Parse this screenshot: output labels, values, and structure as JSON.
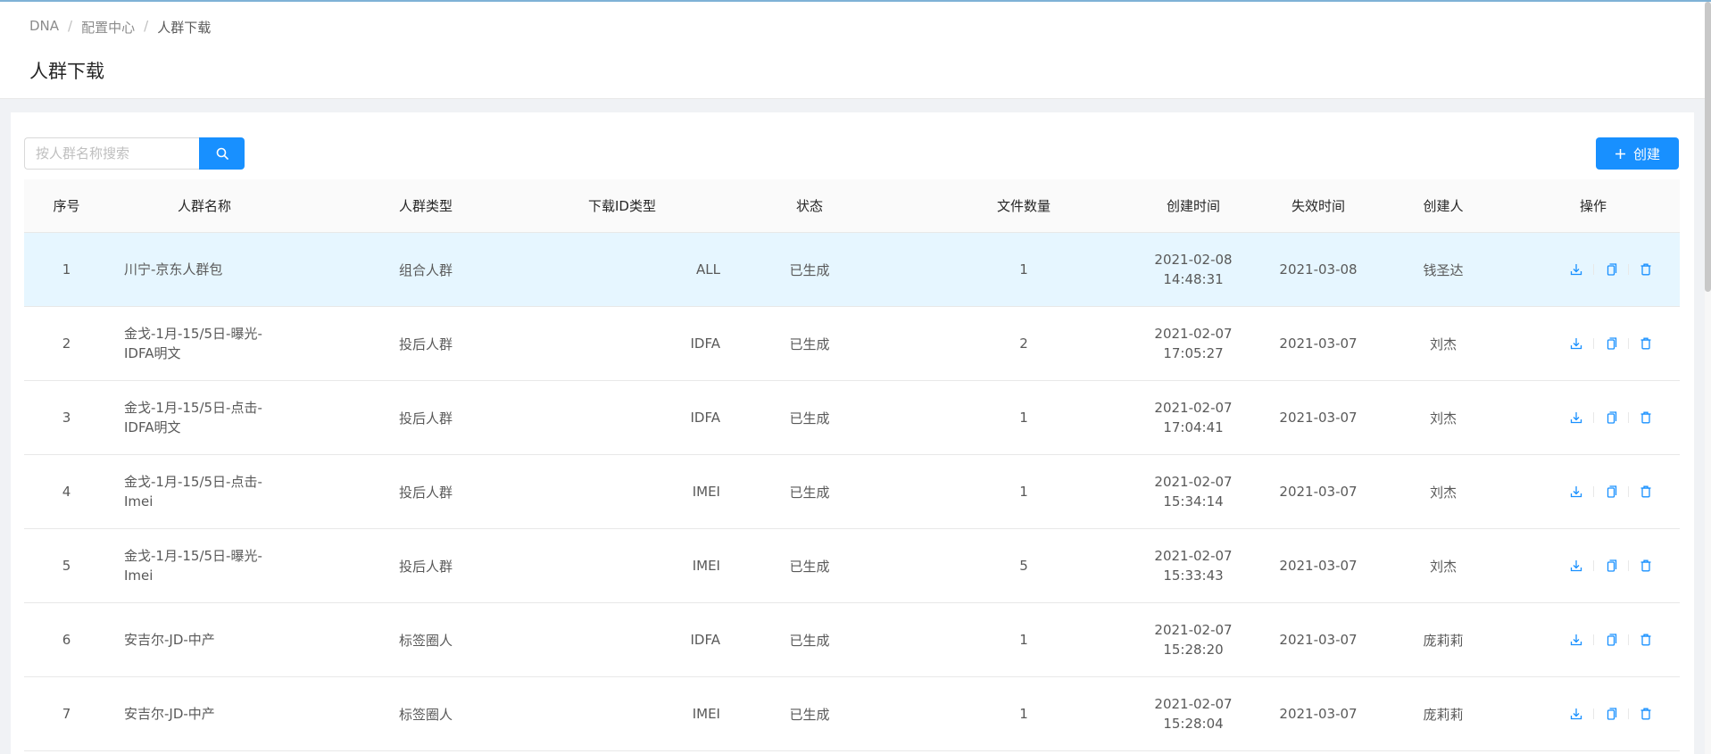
{
  "breadcrumb": [
    "DNA",
    "配置中心",
    "人群下载"
  ],
  "page_title": "人群下载",
  "search": {
    "placeholder": "按人群名称搜索",
    "value": ""
  },
  "create_button": "创建",
  "columns": [
    "序号",
    "人群名称",
    "人群类型",
    "下载ID类型",
    "状态",
    "文件数量",
    "创建时间",
    "失效时间",
    "创建人",
    "操作"
  ],
  "rows": [
    {
      "idx": "1",
      "name": "川宁-京东人群包",
      "type": "组合人群",
      "id_type": "ALL",
      "status": "已生成",
      "count": "1",
      "created_date": "2021-02-08",
      "created_time": "14:48:31",
      "expire": "2021-03-08",
      "creator": "钱圣达"
    },
    {
      "idx": "2",
      "name": "金戈-1月-15/5日-曝光-IDFA明文",
      "type": "投后人群",
      "id_type": "IDFA",
      "status": "已生成",
      "count": "2",
      "created_date": "2021-02-07",
      "created_time": "17:05:27",
      "expire": "2021-03-07",
      "creator": "刘杰"
    },
    {
      "idx": "3",
      "name": "金戈-1月-15/5日-点击-IDFA明文",
      "type": "投后人群",
      "id_type": "IDFA",
      "status": "已生成",
      "count": "1",
      "created_date": "2021-02-07",
      "created_time": "17:04:41",
      "expire": "2021-03-07",
      "creator": "刘杰"
    },
    {
      "idx": "4",
      "name": "金戈-1月-15/5日-点击-Imei",
      "type": "投后人群",
      "id_type": "IMEI",
      "status": "已生成",
      "count": "1",
      "created_date": "2021-02-07",
      "created_time": "15:34:14",
      "expire": "2021-03-07",
      "creator": "刘杰"
    },
    {
      "idx": "5",
      "name": "金戈-1月-15/5日-曝光-Imei",
      "type": "投后人群",
      "id_type": "IMEI",
      "status": "已生成",
      "count": "5",
      "created_date": "2021-02-07",
      "created_time": "15:33:43",
      "expire": "2021-03-07",
      "creator": "刘杰"
    },
    {
      "idx": "6",
      "name": "安吉尔-JD-中产",
      "type": "标签圈人",
      "id_type": "IDFA",
      "status": "已生成",
      "count": "1",
      "created_date": "2021-02-07",
      "created_time": "15:28:20",
      "expire": "2021-03-07",
      "creator": "庞莉莉"
    },
    {
      "idx": "7",
      "name": "安吉尔-JD-中产",
      "type": "标签圈人",
      "id_type": "IMEI",
      "status": "已生成",
      "count": "1",
      "created_date": "2021-02-07",
      "created_time": "15:28:04",
      "expire": "2021-03-07",
      "creator": "庞莉莉"
    }
  ],
  "row_actions": [
    "download-icon",
    "copy-icon",
    "delete-icon"
  ],
  "colors": {
    "primary": "#1890ff",
    "selected_row": "#e6f6ff"
  }
}
